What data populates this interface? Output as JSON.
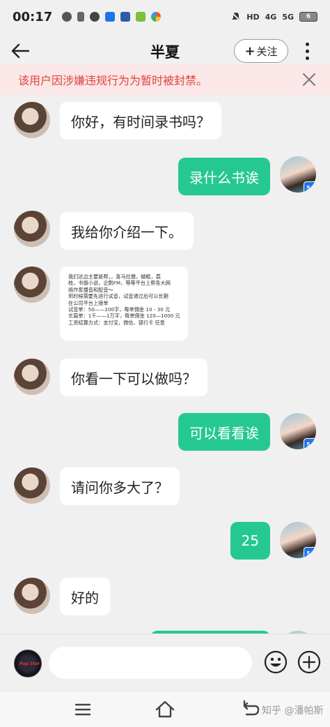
{
  "status_bar": {
    "time": "00:17",
    "network_1": "HD",
    "network_2": "4G",
    "network_3": "5G",
    "battery": "6"
  },
  "header": {
    "title": "半夏",
    "follow_label": "关注",
    "follow_plus": "+"
  },
  "ban_notice": {
    "text": "该用户因涉嫌违规行为为暂时被封禁。"
  },
  "messages": [
    {
      "side": "left",
      "text": "你好，有时间录书吗？"
    },
    {
      "side": "right",
      "text": "录什么书诶"
    },
    {
      "side": "left",
      "text": "我给你介绍一下。"
    },
    {
      "side": "left",
      "type": "image",
      "lines": [
        "我们这边主要是帮，，喜马拉雅，蜻蜓，荔",
        "枝，书旗小说，企鹅FM，等等平台上帮各大网",
        "络作家播音和配音～",
        "到时候需要先进行试音，试音通过后可以长期",
        "在公司平台上接单",
        "试音单：50——200字，每单佣金 10 - 30 元",
        "长篇单：1千——1万字，每单佣金 120—1000 元",
        "工资结算方式：支付宝，微信，银行卡 任意"
      ]
    },
    {
      "side": "left",
      "text": "你看一下可以做吗？"
    },
    {
      "side": "right",
      "text": "可以看看诶"
    },
    {
      "side": "left",
      "text": "请问你多大了？"
    },
    {
      "side": "right",
      "text": "25"
    },
    {
      "side": "left",
      "text": "好的"
    }
  ],
  "badge_label": "5A",
  "my_avatar_text": "Pop Star",
  "input": {
    "placeholder": ""
  },
  "watermark": "知乎 @潘帕斯",
  "colors": {
    "accent_green": "#26c892",
    "ban_bg": "#fbe7e7",
    "ban_text": "#e0433e",
    "badge_blue": "#1e74e8"
  }
}
